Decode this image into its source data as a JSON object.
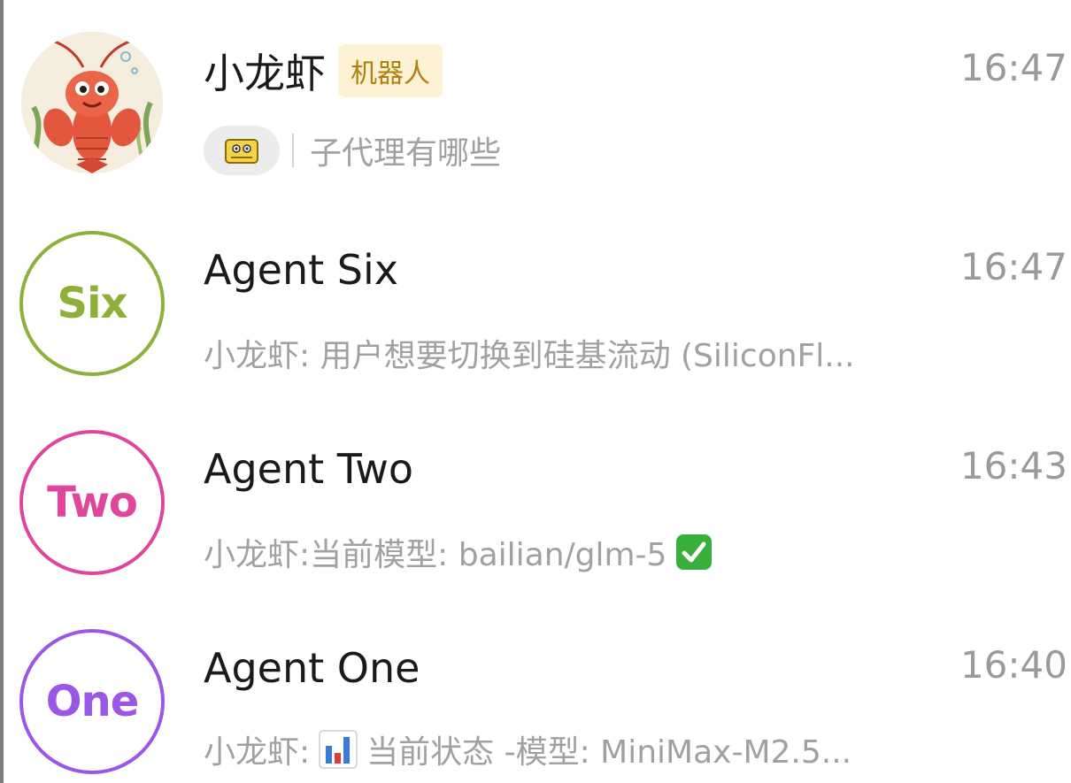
{
  "chats": [
    {
      "name": "小龙虾",
      "badge": "机器人",
      "time": "16:47",
      "preview": "子代理有哪些",
      "avatar_icon": "crayfish-avatar-icon",
      "preview_icon": "sticker-icon"
    },
    {
      "name": "Agent Six",
      "time": "16:47",
      "avatar_label": "Six",
      "avatar_color": "#8eb03a",
      "preview": "小龙虾: 用户想要切换到硅基流动 (SiliconFl..."
    },
    {
      "name": "Agent Two",
      "time": "16:43",
      "avatar_label": "Two",
      "avatar_color": "#e0459c",
      "preview_prefix": "小龙虾: ",
      "preview_main": "当前模型: bailian/glm-5",
      "preview_icon": "check-mark-icon"
    },
    {
      "name": "Agent One",
      "time": "16:40",
      "avatar_label": "One",
      "avatar_color": "#9a57e6",
      "preview_prefix": "小龙虾: ",
      "preview_icon": "bar-chart-icon",
      "preview_main": "当前状态 -模型: MiniMax-M2.5..."
    }
  ]
}
